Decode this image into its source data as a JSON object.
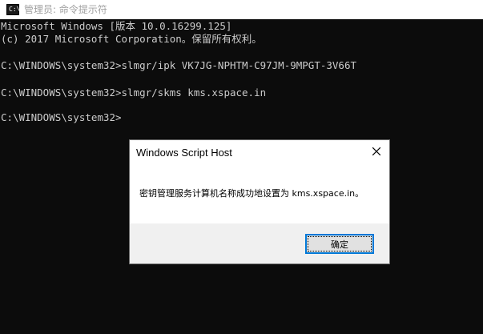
{
  "window": {
    "title": "管理员: 命令提示符",
    "icon": "cmd-prompt-icon",
    "icon_glyph": "C:\\"
  },
  "console": {
    "lines": [
      "Microsoft Windows [版本 10.0.16299.125]",
      "(c) 2017 Microsoft Corporation。保留所有权利。",
      "",
      "C:\\WINDOWS\\system32>slmgr/ipk VK7JG-NPHTM-C97JM-9MPGT-3V66T",
      "",
      "C:\\WINDOWS\\system32>slmgr/skms kms.xspace.in",
      "",
      "C:\\WINDOWS\\system32>"
    ]
  },
  "dialog": {
    "title": "Windows Script Host",
    "message": "密钥管理服务计算机名称成功地设置为 kms.xspace.in。",
    "ok_label": "确定",
    "close_icon": "close-icon"
  },
  "colors": {
    "console_bg": "#0c0c0c",
    "console_text": "#cccccc",
    "dialog_footer": "#f0f0f0",
    "button_focus": "#0078d7"
  }
}
